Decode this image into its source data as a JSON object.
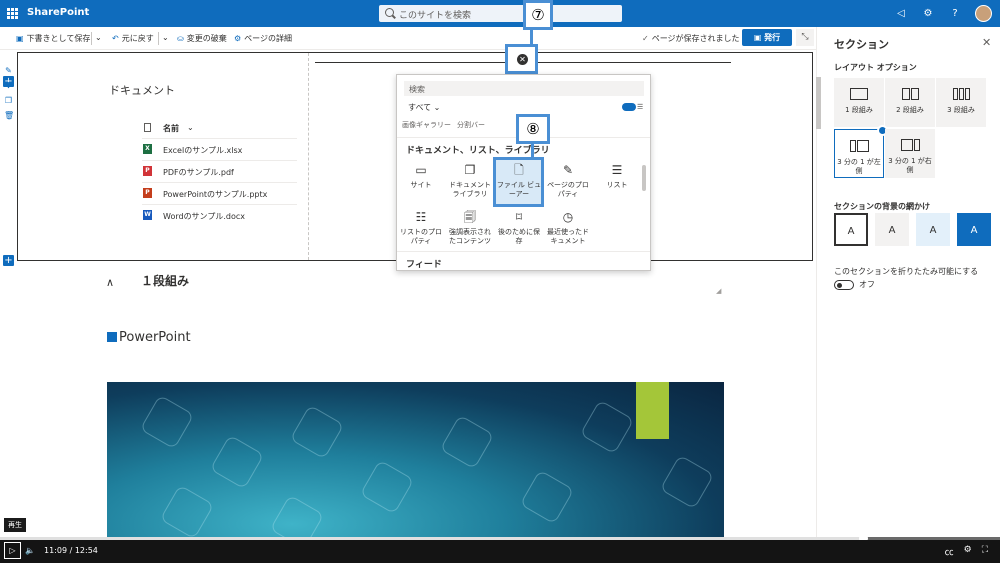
{
  "suite": {
    "app_title": "SharePoint",
    "search_placeholder": "このサイトを検索",
    "icons": [
      "megaphone-icon",
      "gear-icon",
      "help-icon",
      "avatar"
    ]
  },
  "command_bar": {
    "save_draft": "下書きとして保存",
    "undo": "元に戻す",
    "discard": "変更の破棄",
    "page_details": "ページの詳細",
    "saved_status": "ページが保存されました",
    "publish": "発行"
  },
  "section": {
    "doc_title": "ドキュメント",
    "doc_column_name": "名前",
    "documents": [
      {
        "name": "Excelのサンプル.xlsx",
        "icon": "excel-file-icon",
        "color": "#1d6f42",
        "glyph": "X"
      },
      {
        "name": "PDFのサンプル.pdf",
        "icon": "pdf-file-icon",
        "color": "#d13438",
        "glyph": "P"
      },
      {
        "name": "PowerPointのサンプル.pptx",
        "icon": "powerpoint-file-icon",
        "color": "#c43e1c",
        "glyph": "P"
      },
      {
        "name": "Wordのサンプル.docx",
        "icon": "word-file-icon",
        "color": "#185abd",
        "glyph": "W"
      }
    ]
  },
  "callouts": {
    "step7": "⑦",
    "step8": "⑧"
  },
  "picker": {
    "search_placeholder": "検索",
    "filter": "すべて ⌄",
    "cut_labels": [
      "画像ギャラリー",
      "分割バー"
    ],
    "category": "ドキュメント、リスト、ライブラリ",
    "items": [
      {
        "label": "サイト",
        "icon": "site-icon",
        "glyph": "▭"
      },
      {
        "label": "ドキュメント ライブラリ",
        "icon": "document-library-icon",
        "glyph": "❐"
      },
      {
        "label": "ファイル ビューアー",
        "icon": "file-viewer-icon",
        "glyph": "🗋"
      },
      {
        "label": "ページのプロパティ",
        "icon": "page-properties-icon",
        "glyph": "✎"
      },
      {
        "label": "リスト",
        "icon": "list-icon",
        "glyph": "☰"
      },
      {
        "label": "リストのプロパティ",
        "icon": "list-properties-icon",
        "glyph": "☷"
      },
      {
        "label": "強調表示されたコンテンツ",
        "icon": "highlighted-content-icon",
        "glyph": "🗐"
      },
      {
        "label": "後のために保存",
        "icon": "bookmark-icon",
        "glyph": "⌑"
      },
      {
        "label": "最近使ったドキュメント",
        "icon": "clock-icon",
        "glyph": "◷"
      }
    ],
    "feed_category": "フィード"
  },
  "canvas": {
    "section_label": "１段組み",
    "powerpoint_heading": "PowerPoint"
  },
  "right_panel": {
    "title": "セクション",
    "layout_heading": "レイアウト オプション",
    "layouts": [
      {
        "label": "1 段組み",
        "cols": 1
      },
      {
        "label": "2 段組み",
        "cols": 2
      },
      {
        "label": "3 段組み",
        "cols": 3
      },
      {
        "label": "3 分の 1 が左側",
        "cols": 2,
        "selected": true
      },
      {
        "label": "3 分の 1 が右側",
        "cols": 2
      }
    ],
    "background_heading": "セクションの背景の網かけ",
    "backgrounds": [
      {
        "label": "A",
        "bg": "#ffffff",
        "fg": "#323130",
        "selected": true
      },
      {
        "label": "A",
        "bg": "#f3f2f1",
        "fg": "#323130"
      },
      {
        "label": "A",
        "bg": "#e3f0fa",
        "fg": "#323130"
      },
      {
        "label": "A",
        "bg": "#0f6cbd",
        "fg": "#ffffff"
      }
    ],
    "collapsible_label": "このセクションを折りたたみ可能にする",
    "toggle_state": "オフ"
  },
  "player": {
    "tooltip": "再生",
    "time": "11:09 / 12:54",
    "progress_fraction": 0.863
  },
  "colors": {
    "accent": "#0f6cbd",
    "callout": "#4a8fd4"
  }
}
